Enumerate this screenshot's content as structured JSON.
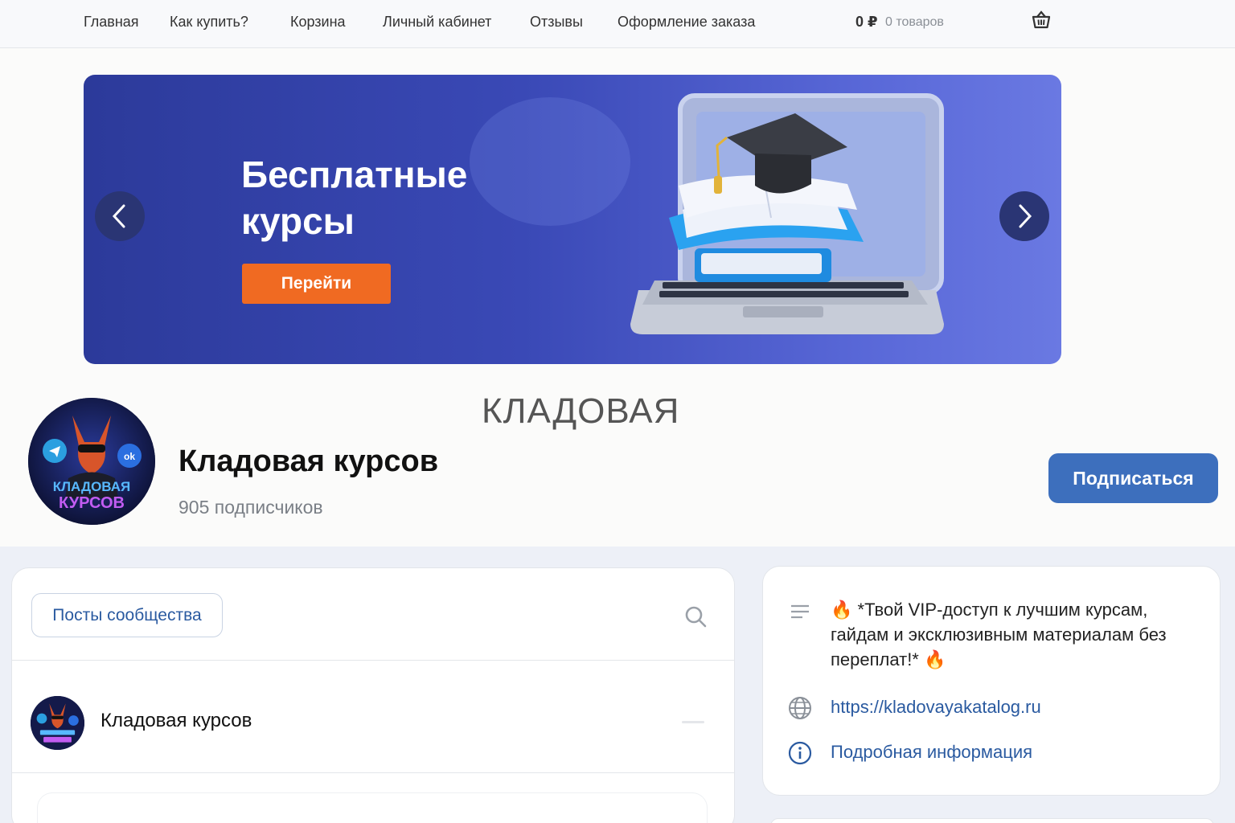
{
  "nav": {
    "items": [
      "Главная",
      "Как купить?",
      "Корзина",
      "Личный кабинет",
      "Отзывы",
      "Оформление заказа"
    ],
    "cart_price": "0 ₽",
    "cart_count": "0 товаров",
    "basket_icon": "basket-icon"
  },
  "banner": {
    "title": "Бесплатные курсы",
    "button": "Перейти",
    "accent": "#f06a22"
  },
  "profile": {
    "cover_title": "КЛАДОВАЯ",
    "name": "Кладовая курсов",
    "subscribers": "905 подписчиков",
    "subscribe_button": "Подписаться",
    "avatar_text_top": "КЛАДОВАЯ",
    "avatar_text_bottom": "КУРСОВ",
    "brand_color": "#3d6fbd"
  },
  "feed": {
    "tab_label": "Посты сообщества",
    "post_author": "Кладовая курсов"
  },
  "info": {
    "description": "🔥 *Твой VIP-доступ к лучшим курсам, гайдам и эксклюзивным материалам без переплат!* 🔥",
    "link": "https://kladovayakatalog.ru",
    "more": "Подробная информация"
  }
}
